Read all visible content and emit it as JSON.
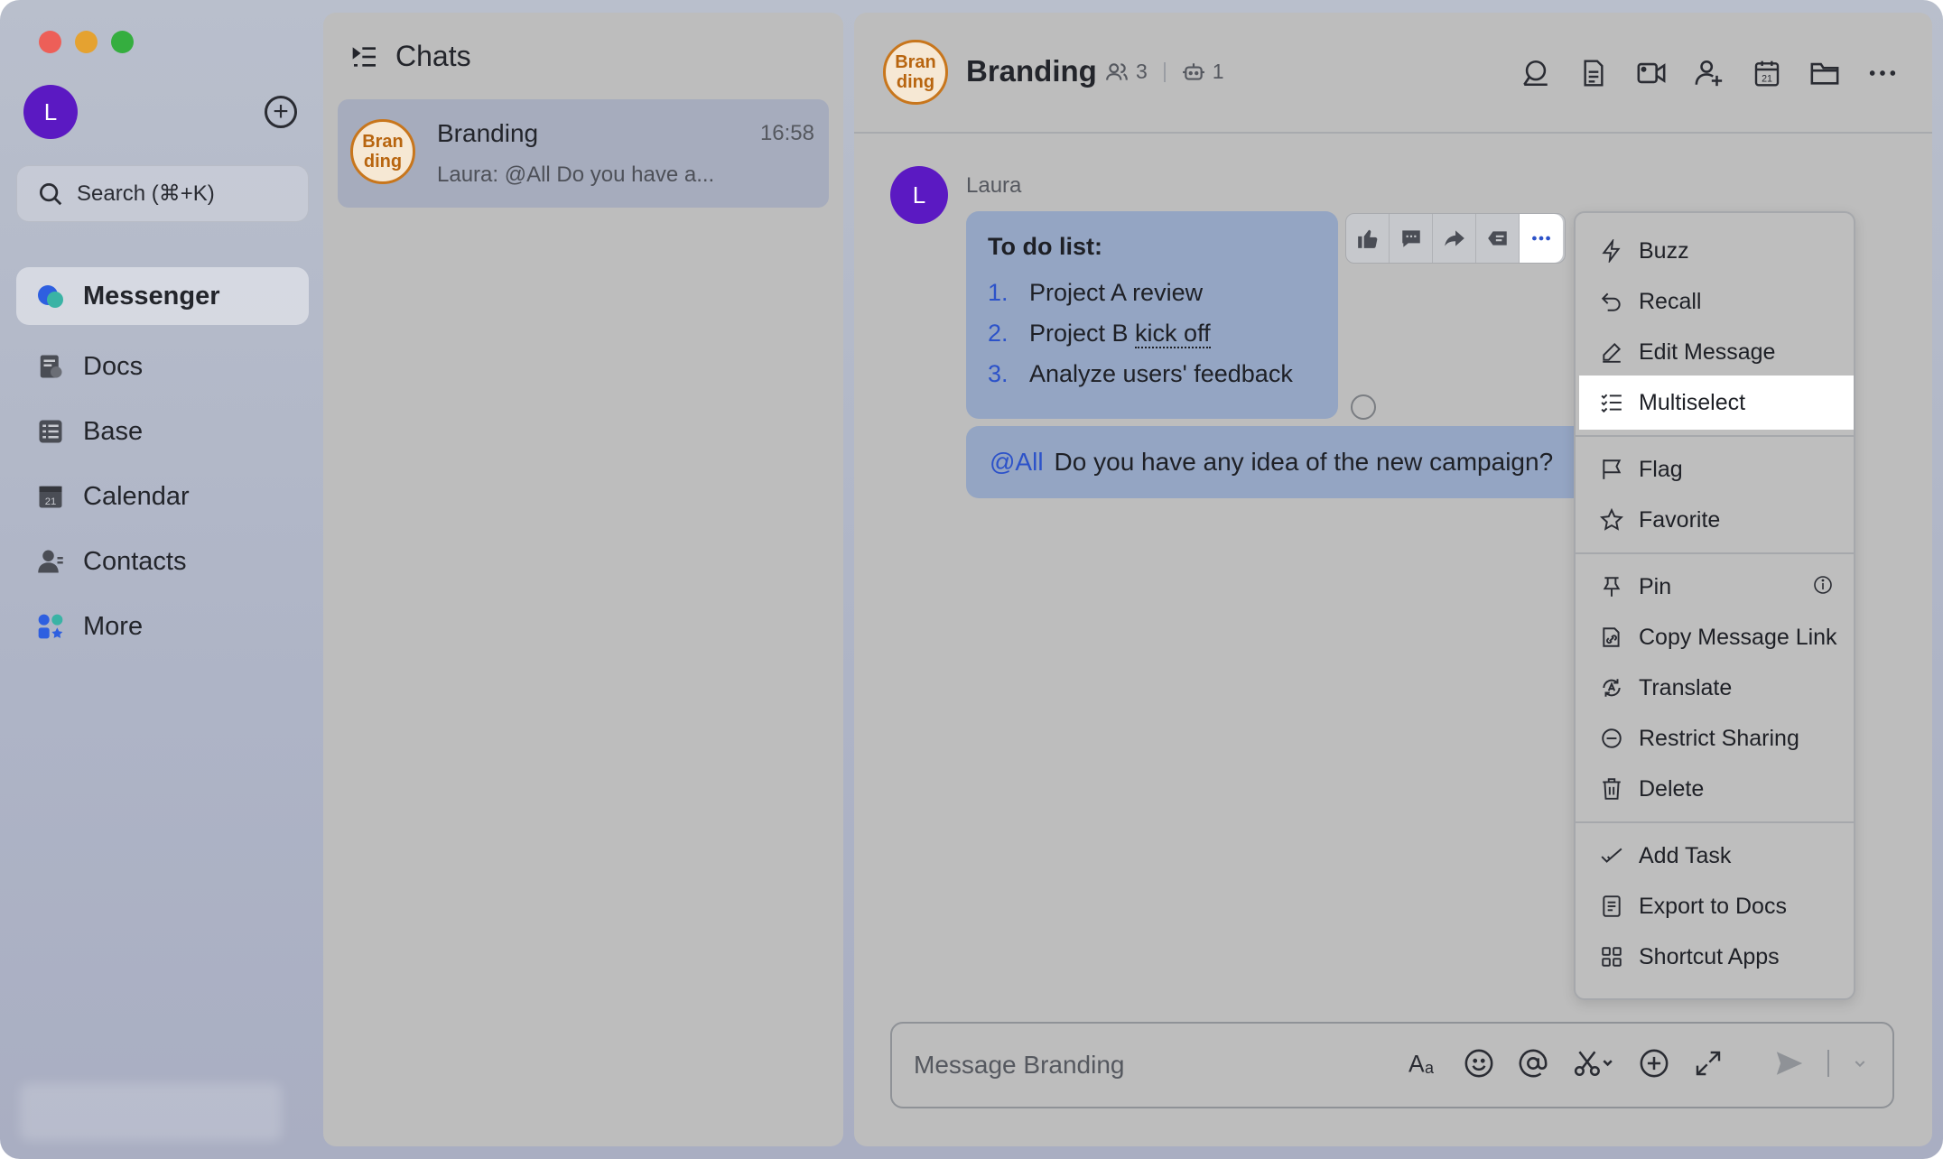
{
  "sidebar": {
    "user_initial": "L",
    "add_symbol": "+",
    "search_placeholder": "Search (⌘+K)",
    "items": [
      {
        "label": "Messenger",
        "icon": "messenger-icon"
      },
      {
        "label": "Docs",
        "icon": "docs-icon"
      },
      {
        "label": "Base",
        "icon": "base-icon"
      },
      {
        "label": "Calendar",
        "icon": "calendar-icon"
      },
      {
        "label": "Contacts",
        "icon": "contacts-icon"
      },
      {
        "label": "More",
        "icon": "more-apps-icon"
      }
    ]
  },
  "chats": {
    "title": "Chats",
    "list": [
      {
        "avatar_line1": "Bran",
        "avatar_line2": "ding",
        "name": "Branding",
        "time": "16:58",
        "preview": "Laura: @All Do you have a..."
      }
    ]
  },
  "conversation": {
    "avatar_line1": "Bran",
    "avatar_line2": "ding",
    "title": "Branding",
    "members_count": "3",
    "bots_count": "1",
    "sender_initial": "L",
    "sender_name": "Laura",
    "todo_title": "To do list:",
    "todo_items": [
      {
        "num": "1.",
        "text": "Project A review"
      },
      {
        "num": "2.",
        "text_before": "Project B ",
        "text_dotted": "kick off"
      },
      {
        "num": "3.",
        "text": "Analyze users' feedback"
      }
    ],
    "mention": "@All",
    "message": "Do you have any idea of the new campaign?"
  },
  "context_menu": {
    "items": [
      {
        "label": "Buzz",
        "icon": "lightning-icon"
      },
      {
        "label": "Recall",
        "icon": "undo-icon"
      },
      {
        "label": "Edit Message",
        "icon": "pencil-icon"
      },
      {
        "label": "Multiselect",
        "icon": "checklist-icon",
        "active": true
      },
      {
        "label": "Flag",
        "icon": "flag-icon"
      },
      {
        "label": "Favorite",
        "icon": "star-icon"
      },
      {
        "label": "Pin",
        "icon": "pin-icon"
      },
      {
        "label": "Copy Message Link",
        "icon": "link-icon"
      },
      {
        "label": "Translate",
        "icon": "translate-icon"
      },
      {
        "label": "Restrict Sharing",
        "icon": "restrict-icon"
      },
      {
        "label": "Delete",
        "icon": "trash-icon"
      },
      {
        "label": "Add Task",
        "icon": "task-icon"
      },
      {
        "label": "Export to Docs",
        "icon": "export-docs-icon"
      },
      {
        "label": "Shortcut Apps",
        "icon": "apps-grid-icon"
      }
    ]
  },
  "composer": {
    "placeholder": "Message Branding"
  }
}
